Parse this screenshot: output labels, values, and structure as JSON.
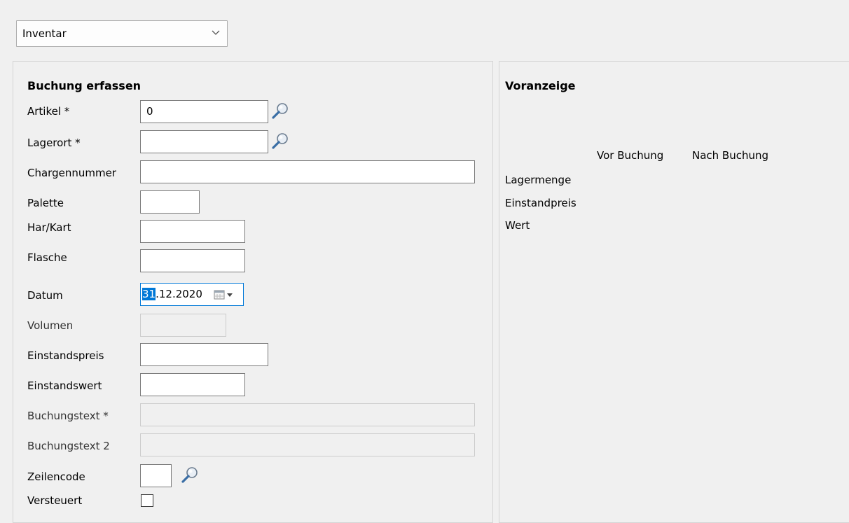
{
  "toolbar": {
    "mode_select": "Inventar"
  },
  "form": {
    "title": "Buchung erfassen",
    "artikel_label": "Artikel *",
    "artikel_value": "0",
    "lagerort_label": "Lagerort *",
    "lagerort_value": "",
    "charge_label": "Chargennummer",
    "charge_value": "",
    "palette_label": "Palette",
    "palette_value": "",
    "harkart_label": "Har/Kart",
    "harkart_value": "",
    "flasche_label": "Flasche",
    "flasche_value": "",
    "datum_label": "Datum",
    "datum_day_selected": "31",
    "datum_rest": ".12.2020",
    "volumen_label": "Volumen",
    "volumen_value": "",
    "einstandspreis_label": "Einstandspreis",
    "einstandspreis_value": "",
    "einstandswert_label": "Einstandswert",
    "einstandswert_value": "",
    "buchungstext_label": "Buchungstext *",
    "buchungstext_value": "",
    "buchungstext2_label": "Buchungstext 2",
    "buchungstext2_value": "",
    "zeilencode_label": "Zeilencode",
    "zeilencode_value": "",
    "versteuert_label": "Versteuert",
    "versteuert_checked": false
  },
  "preview": {
    "title": "Voranzeige",
    "col_before": "Vor Buchung",
    "col_after": "Nach Buchung",
    "rows": [
      "Lagermenge",
      "Einstandpreis",
      "Wert"
    ]
  },
  "colors": {
    "accent": "#0078d7",
    "background": "#f0f0f0"
  }
}
